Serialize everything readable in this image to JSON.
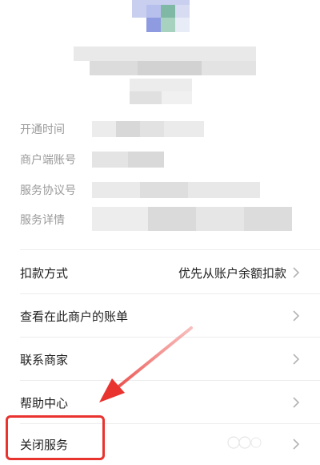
{
  "details": {
    "labels": [
      "开通时间",
      "商户端账号",
      "服务协议号",
      "服务详情"
    ]
  },
  "menu": [
    {
      "label": "扣款方式",
      "value": "优先从账户余额扣款"
    },
    {
      "label": "查看在此商户的账单",
      "value": ""
    },
    {
      "label": "联系商家",
      "value": ""
    },
    {
      "label": "帮助中心",
      "value": ""
    },
    {
      "label": "关闭服务",
      "value": ""
    }
  ],
  "colors": {
    "annotation_red": "#e8332f",
    "label_gray": "#9a9a9a",
    "divider": "#ececec"
  },
  "icons": {
    "chevron": "chevron-right-icon",
    "annotation_arrow": "arrow-icon"
  }
}
